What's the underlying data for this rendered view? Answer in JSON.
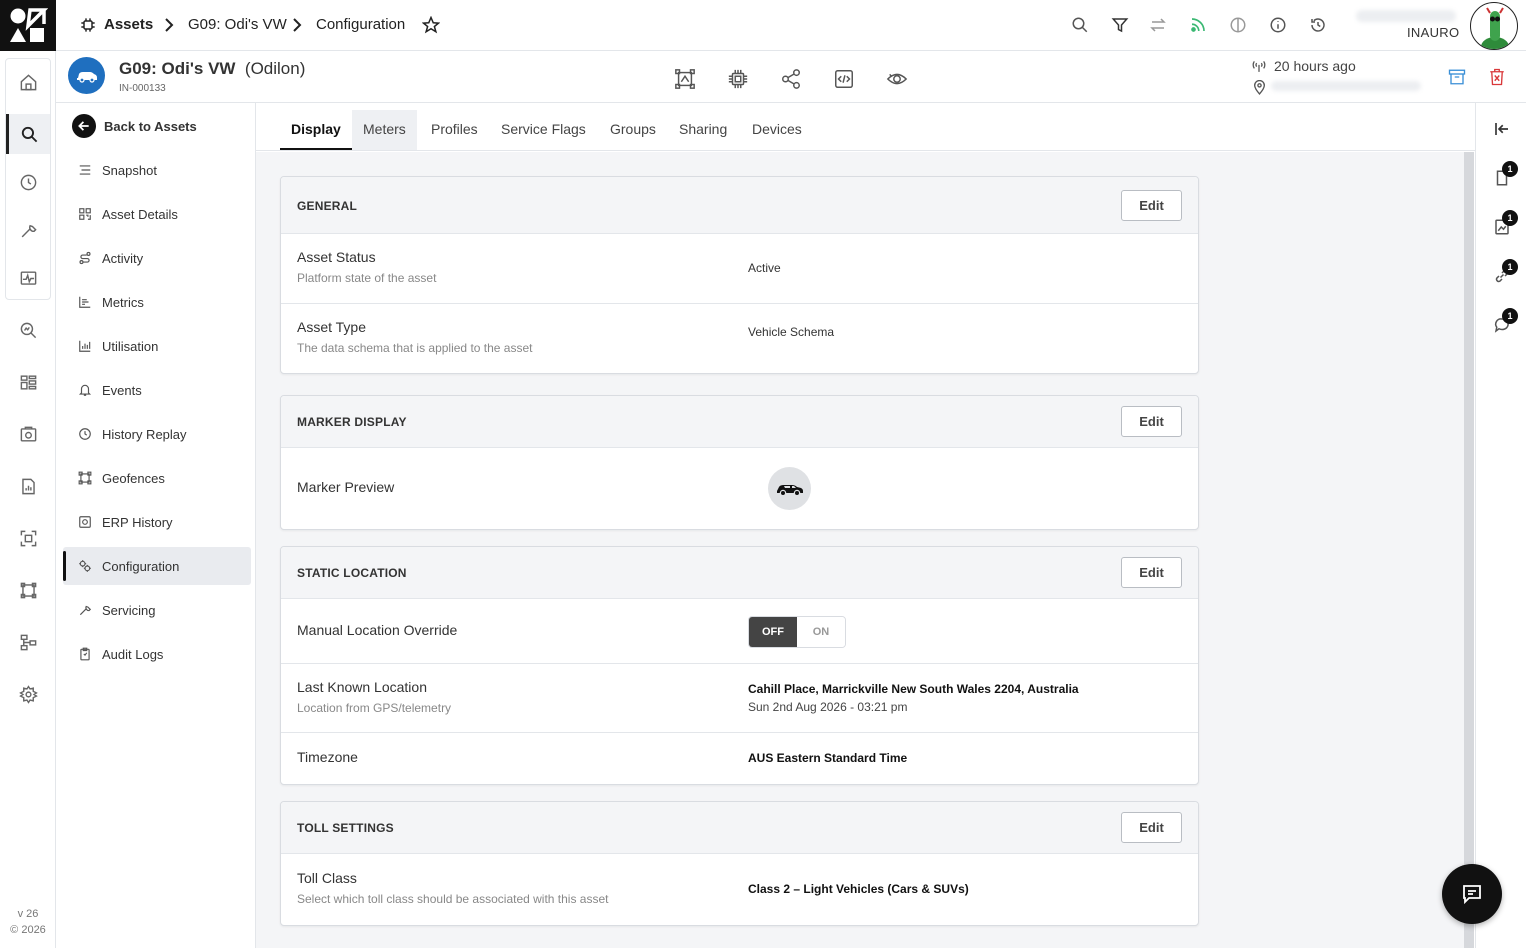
{
  "breadcrumb": {
    "root": "Assets",
    "asset": "G09: Odi's VW",
    "current": "Configuration"
  },
  "topbar": {
    "org": "INAURO",
    "icons": [
      "search-icon",
      "filter-icon",
      "swap-icon",
      "feed-icon",
      "theme-icon",
      "info-icon",
      "history-icon"
    ]
  },
  "asset": {
    "name": "G09: Odi's VW",
    "owner": "(Odilon)",
    "id": "IN-000133",
    "last_seen": "20 hours ago"
  },
  "sidenav": {
    "back_label": "Back to Assets",
    "items": [
      {
        "label": "Snapshot",
        "icon": "list-icon"
      },
      {
        "label": "Asset Details",
        "icon": "qr-icon"
      },
      {
        "label": "Activity",
        "icon": "route-icon"
      },
      {
        "label": "Metrics",
        "icon": "bars-icon"
      },
      {
        "label": "Utilisation",
        "icon": "chart-icon"
      },
      {
        "label": "Events",
        "icon": "bell-icon"
      },
      {
        "label": "History Replay",
        "icon": "clock-icon"
      },
      {
        "label": "Geofences",
        "icon": "geofence-icon"
      },
      {
        "label": "ERP History",
        "icon": "erp-icon"
      },
      {
        "label": "Configuration",
        "icon": "config-icon",
        "active": true
      },
      {
        "label": "Servicing",
        "icon": "wrench-icon"
      },
      {
        "label": "Audit Logs",
        "icon": "clipboard-icon"
      }
    ]
  },
  "tabs": [
    "Display",
    "Meters",
    "Profiles",
    "Service Flags",
    "Groups",
    "Sharing",
    "Devices"
  ],
  "cards": {
    "general": {
      "title": "GENERAL",
      "edit": "Edit",
      "asset_status": {
        "label": "Asset Status",
        "sub": "Platform state of the asset",
        "value": "Active"
      },
      "asset_type": {
        "label": "Asset Type",
        "sub": "The data schema that is applied to the asset",
        "value": "Vehicle Schema"
      }
    },
    "marker": {
      "title": "MARKER DISPLAY",
      "edit": "Edit",
      "preview_label": "Marker Preview"
    },
    "static_location": {
      "title": "STATIC LOCATION",
      "edit": "Edit",
      "override": {
        "label": "Manual Location Override",
        "off": "OFF",
        "on": "ON",
        "state": "OFF"
      },
      "last_known": {
        "label": "Last Known Location",
        "sub": "Location from GPS/telemetry",
        "value": "Cahill Place, Marrickville New South Wales 2204, Australia",
        "time": "Sun 2nd Aug 2026 - 03:21 pm"
      },
      "timezone": {
        "label": "Timezone",
        "value": "AUS Eastern Standard Time"
      }
    },
    "toll": {
      "title": "TOLL SETTINGS",
      "edit": "Edit",
      "toll_class": {
        "label": "Toll Class",
        "sub": "Select which toll class should be associated with this asset",
        "value": "Class 2 – Light Vehicles (Cars & SUVs)"
      }
    }
  },
  "right_rail": {
    "badges": [
      "1",
      "1",
      "1",
      "1"
    ]
  },
  "footer": {
    "version": "v 26",
    "copyright": "© 2026"
  },
  "colors": {
    "accent": "#1f6fbf",
    "archive": "#3a8fd6",
    "delete": "#d9383a",
    "feed": "#3bb873"
  }
}
